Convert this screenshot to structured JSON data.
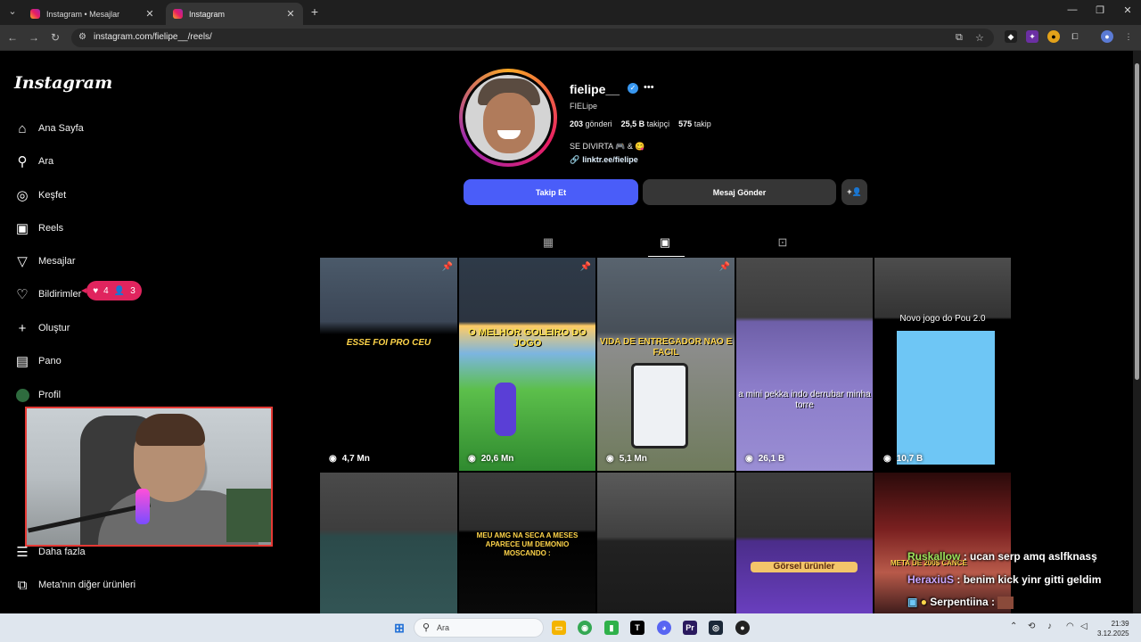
{
  "browser": {
    "tabs": [
      {
        "title": "Instagram • Mesajlar",
        "active": false
      },
      {
        "title": "Instagram",
        "active": true
      }
    ],
    "new_tab_icon": "plus-icon",
    "url": "instagram.com/fielipe__/reels/"
  },
  "sidebar": {
    "logo": "Instagram",
    "items": [
      {
        "label": "Ana Sayfa",
        "icon": "home-icon"
      },
      {
        "label": "Ara",
        "icon": "search-icon"
      },
      {
        "label": "Keşfet",
        "icon": "compass-icon"
      },
      {
        "label": "Reels",
        "icon": "reels-icon"
      },
      {
        "label": "Mesajlar",
        "icon": "send-icon"
      },
      {
        "label": "Bildirimler",
        "icon": "heart-icon"
      },
      {
        "label": "Oluştur",
        "icon": "plus-icon"
      },
      {
        "label": "Pano",
        "icon": "chart-icon"
      },
      {
        "label": "Profil",
        "icon": "avatar"
      },
      {
        "label": "Daha fazla",
        "icon": "menu-icon"
      },
      {
        "label": "Meta'nın diğer ürünleri",
        "icon": "meta-grid-icon"
      }
    ],
    "notification_badge": {
      "likes": "4",
      "follows": "3"
    }
  },
  "profile": {
    "username": "fielipe__",
    "full_name": "FIELipe",
    "stats": {
      "posts_count": "203",
      "posts_label": "gönderi",
      "followers_count": "25,5 B",
      "followers_label": "takipçi",
      "following_count": "575",
      "following_label": "takip"
    },
    "bio": "SE DIVIRTA 🎮 & 😋",
    "link": "linktr.ee/fielipe",
    "buttons": {
      "follow": "Takip Et",
      "message": "Mesaj Gönder",
      "suggest_icon": "add-person-icon"
    }
  },
  "tabs": [
    {
      "name": "posts",
      "icon": "grid-icon",
      "active": false
    },
    {
      "name": "reels",
      "icon": "reels-icon",
      "active": true
    },
    {
      "name": "tagged",
      "icon": "tagged-icon",
      "active": false
    }
  ],
  "reels": [
    {
      "caption": "ESSE FOI PRO CEU",
      "views": "4,7 Mn",
      "pinned": true
    },
    {
      "caption": "O MELHOR GOLEIRO DO JOGO",
      "views": "20,6 Mn",
      "pinned": true
    },
    {
      "caption": "VIDA DE ENTREGADOR NAO E FACIL",
      "views": "5,1 Mn",
      "pinned": true
    },
    {
      "caption": "a mini pekka indo derrubar minha torre",
      "views": "26,1 B",
      "pinned": false
    },
    {
      "caption": "Novo jogo do Pou 2.0",
      "views": "10,7 B",
      "pinned": false
    },
    {
      "caption": "",
      "views": "",
      "pinned": false
    },
    {
      "caption": "MEU AMG NA SECA A MESES APARECE UM DEMONIO MOSCANDO :",
      "views": "",
      "pinned": false
    },
    {
      "caption": "",
      "views": "",
      "pinned": false
    },
    {
      "caption": "Görsel ürünler",
      "views": "",
      "pinned": false
    },
    {
      "caption": "META DE 200$ CANCE",
      "views": "",
      "pinned": false
    }
  ],
  "chat": [
    {
      "user": "Ruskallow",
      "message": "ucan serp amq aslfknasş",
      "color": "#9be35b"
    },
    {
      "user": "HeraxiuS",
      "message": "benim kick yinr gitti geldim",
      "color": "#c9a6ff"
    },
    {
      "user": "Serpentiina",
      "message": "",
      "color": "#ffffff"
    }
  ],
  "taskbar": {
    "search_placeholder": "Ara",
    "time": "21:39",
    "date": "3.12.2025"
  },
  "colors": {
    "accent": "#4a5df9",
    "badge": "#e0245e",
    "verified": "#3897f0"
  }
}
